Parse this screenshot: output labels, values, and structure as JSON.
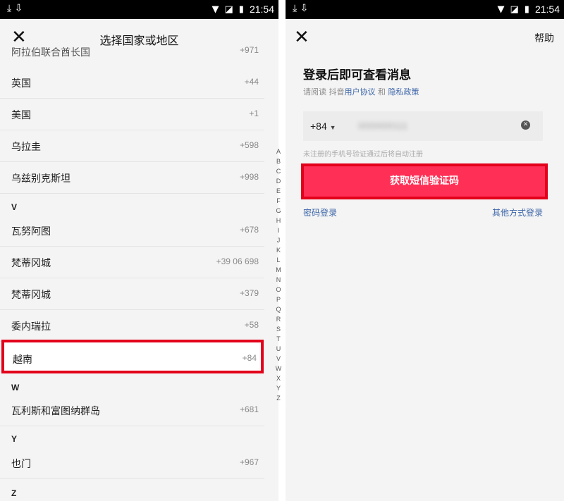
{
  "left": {
    "status": {
      "time": "21:54"
    },
    "title": "选择国家或地区",
    "partial_row": {
      "name": "阿拉伯联合酋长国",
      "code": "+971"
    },
    "rows_u": [
      {
        "name": "英国",
        "code": "+44"
      },
      {
        "name": "美国",
        "code": "+1"
      },
      {
        "name": "乌拉圭",
        "code": "+598"
      },
      {
        "name": "乌兹别克斯坦",
        "code": "+998"
      }
    ],
    "header_v": "V",
    "rows_v": [
      {
        "name": "瓦努阿图",
        "code": "+678"
      },
      {
        "name": "梵蒂冈城",
        "code": "+39 06 698"
      },
      {
        "name": "梵蒂冈城",
        "code": "+379"
      },
      {
        "name": "委内瑞拉",
        "code": "+58"
      }
    ],
    "selected": {
      "name": "越南",
      "code": "+84"
    },
    "header_w": "W",
    "rows_w": [
      {
        "name": "瓦利斯和富图纳群岛",
        "code": "+681"
      }
    ],
    "header_y": "Y",
    "rows_y": [
      {
        "name": "也门",
        "code": "+967"
      }
    ],
    "header_z": "Z",
    "alphabet": [
      "A",
      "B",
      "C",
      "D",
      "E",
      "F",
      "G",
      "H",
      "I",
      "J",
      "K",
      "L",
      "M",
      "N",
      "O",
      "P",
      "Q",
      "R",
      "S",
      "T",
      "U",
      "V",
      "W",
      "X",
      "Y",
      "Z"
    ]
  },
  "right": {
    "status": {
      "time": "21:54"
    },
    "help": "帮助",
    "heading": "登录后即可查看消息",
    "agree_prefix": "请阅读 抖音",
    "agree_user": "用户协议",
    "agree_and": " 和 ",
    "agree_privacy": "隐私政策",
    "country_code": "+84",
    "phone_value": "0000000111",
    "hint": "未注册的手机号验证通过后将自动注册",
    "sms_button": "获取短信验证码",
    "password_login": "密码登录",
    "other_login": "其他方式登录"
  },
  "icons": {
    "close": "close-icon",
    "download": "download-icon",
    "wifi": "wifi-icon",
    "battery": "battery-icon"
  }
}
